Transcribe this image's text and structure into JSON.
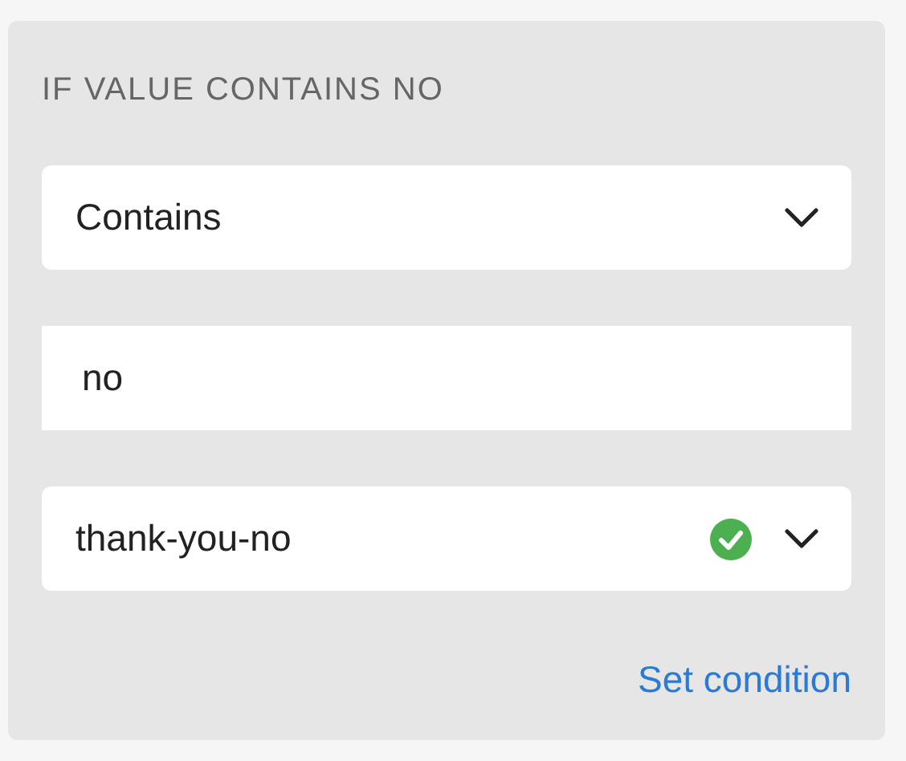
{
  "panel": {
    "title": "IF VALUE CONTAINS NO",
    "fields": [
      {
        "kind": "select",
        "value": "Contains",
        "valid": false
      },
      {
        "kind": "text",
        "value": "no"
      },
      {
        "kind": "select",
        "value": "thank-you-no",
        "valid": true
      }
    ],
    "link": "Set condition"
  }
}
